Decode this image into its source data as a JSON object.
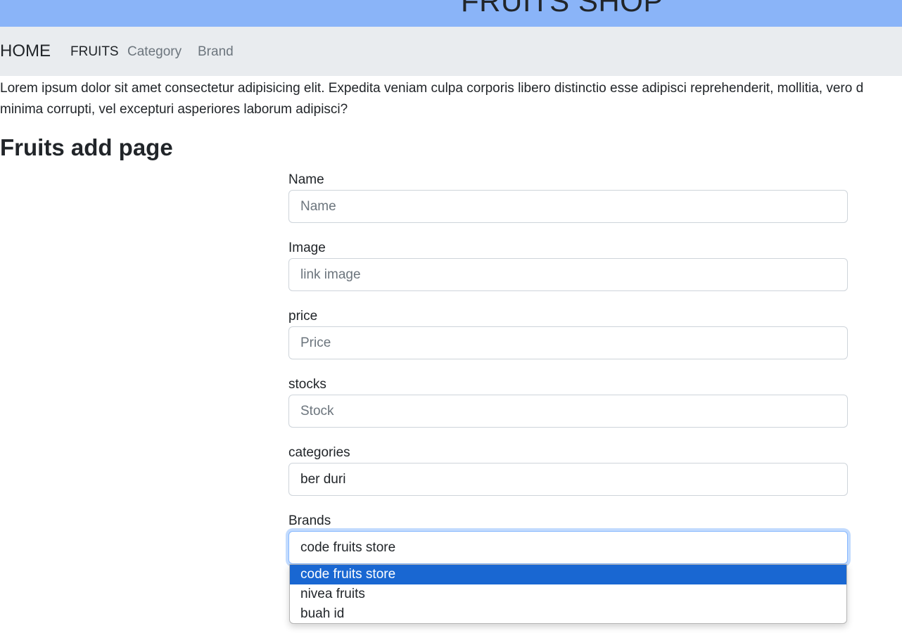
{
  "header": {
    "title": "FRUITS SHOP"
  },
  "navbar": {
    "brand": "HOME",
    "links": [
      {
        "label": "FRUITS"
      },
      {
        "label": "Category"
      },
      {
        "label": "Brand"
      }
    ]
  },
  "intro": {
    "line1": "Lorem ipsum dolor sit amet consectetur adipisicing elit. Expedita veniam culpa corporis libero distinctio esse adipisci reprehenderit, mollitia, vero d",
    "line2": "minima corrupti, vel excepturi asperiores laborum adipisci?"
  },
  "page": {
    "heading": "Fruits add page"
  },
  "form": {
    "name": {
      "label": "Name",
      "placeholder": "Name"
    },
    "image": {
      "label": "Image",
      "placeholder": "link image"
    },
    "price": {
      "label": "price",
      "placeholder": "Price"
    },
    "stocks": {
      "label": "stocks",
      "placeholder": "Stock"
    },
    "categories": {
      "label": "categories",
      "value": "ber duri"
    },
    "brands": {
      "label": "Brands",
      "value": "code fruits store",
      "options": [
        "code fruits store",
        "nivea fruits",
        "buah id"
      ]
    }
  }
}
